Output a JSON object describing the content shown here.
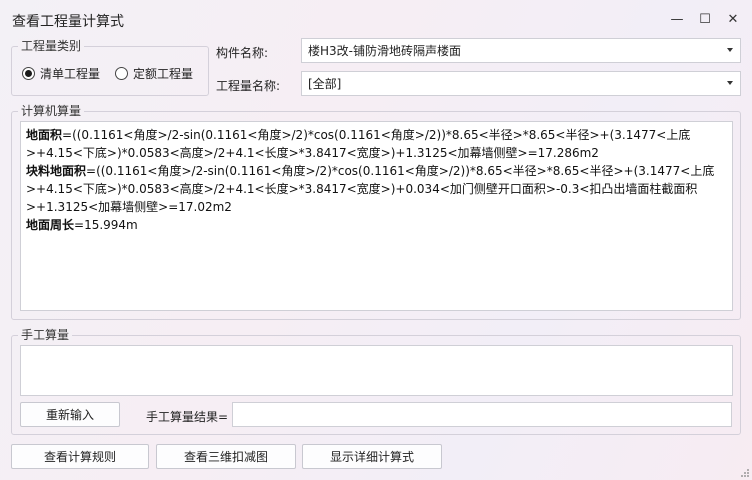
{
  "window": {
    "title": "查看工程量计算式",
    "minimize_glyph": "—",
    "maximize_glyph": "☐",
    "close_glyph": "✕"
  },
  "quantity_type": {
    "group_label": "工程量类别",
    "options": [
      {
        "label": "清单工程量",
        "selected": true
      },
      {
        "label": "定额工程量",
        "selected": false
      }
    ]
  },
  "component": {
    "label": "构件名称:",
    "value": "楼H3改-铺防滑地砖隔声楼面"
  },
  "quantity_name": {
    "label": "工程量名称:",
    "value": "[全部]"
  },
  "computer_calc": {
    "group_label": "计算机算量",
    "lines": [
      {
        "name": "地面积",
        "formula": "=((0.1161<角度>/2-sin(0.1161<角度>/2)*cos(0.1161<角度>/2))*8.65<半径>*8.65<半径>+(3.1477<上底>+4.15<下底>)*0.0583<高度>/2+4.1<长度>*3.8417<宽度>)+1.3125<加幕墙侧壁>=17.286m2"
      },
      {
        "name": "块料地面积",
        "formula": "=((0.1161<角度>/2-sin(0.1161<角度>/2)*cos(0.1161<角度>/2))*8.65<半径>*8.65<半径>+(3.1477<上底>+4.15<下底>)*0.0583<高度>/2+4.1<长度>*3.8417<宽度>)+0.034<加门侧壁开口面积>-0.3<扣凸出墙面柱截面积>+1.3125<加幕墙侧壁>=17.02m2"
      },
      {
        "name": "地面周长",
        "formula": "=15.994m"
      }
    ]
  },
  "manual_calc": {
    "group_label": "手工算量",
    "reenter_button": "重新输入",
    "result_label": "手工算量结果=",
    "result_value": ""
  },
  "footer": {
    "rules_button": "查看计算规则",
    "view3d_button": "查看三维扣减图",
    "detail_button": "显示详细计算式"
  }
}
